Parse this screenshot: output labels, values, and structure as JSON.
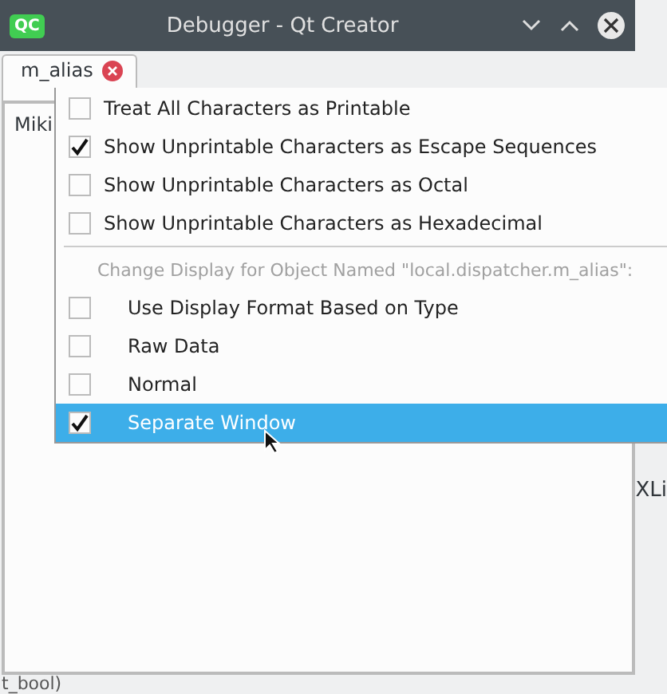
{
  "window": {
    "title": "Debugger - Qt Creator",
    "app_icon": "QC"
  },
  "tab": {
    "label": "m_alias"
  },
  "panel": {
    "text": "Miki",
    "side_text": "XLi",
    "bottom_text": "t_bool)"
  },
  "menu": {
    "items": [
      {
        "kind": "option",
        "label": "Treat All Characters as Printable",
        "checked": false,
        "selected": false
      },
      {
        "kind": "option",
        "label": "Show Unprintable Characters as Escape Sequences",
        "checked": true,
        "selected": false
      },
      {
        "kind": "option",
        "label": "Show Unprintable Characters as Octal",
        "checked": false,
        "selected": false
      },
      {
        "kind": "option",
        "label": "Show Unprintable Characters as Hexadecimal",
        "checked": false,
        "selected": false
      },
      {
        "kind": "separator"
      },
      {
        "kind": "header",
        "label": "Change Display for Object Named \"local.dispatcher.m_alias\":"
      },
      {
        "kind": "format",
        "label": "Use Display Format Based on Type",
        "checked": false,
        "selected": false
      },
      {
        "kind": "format",
        "label": "Raw Data",
        "checked": false,
        "selected": false
      },
      {
        "kind": "format",
        "label": "Normal",
        "checked": false,
        "selected": false
      },
      {
        "kind": "format",
        "label": "Separate Window",
        "checked": true,
        "selected": true
      }
    ]
  }
}
